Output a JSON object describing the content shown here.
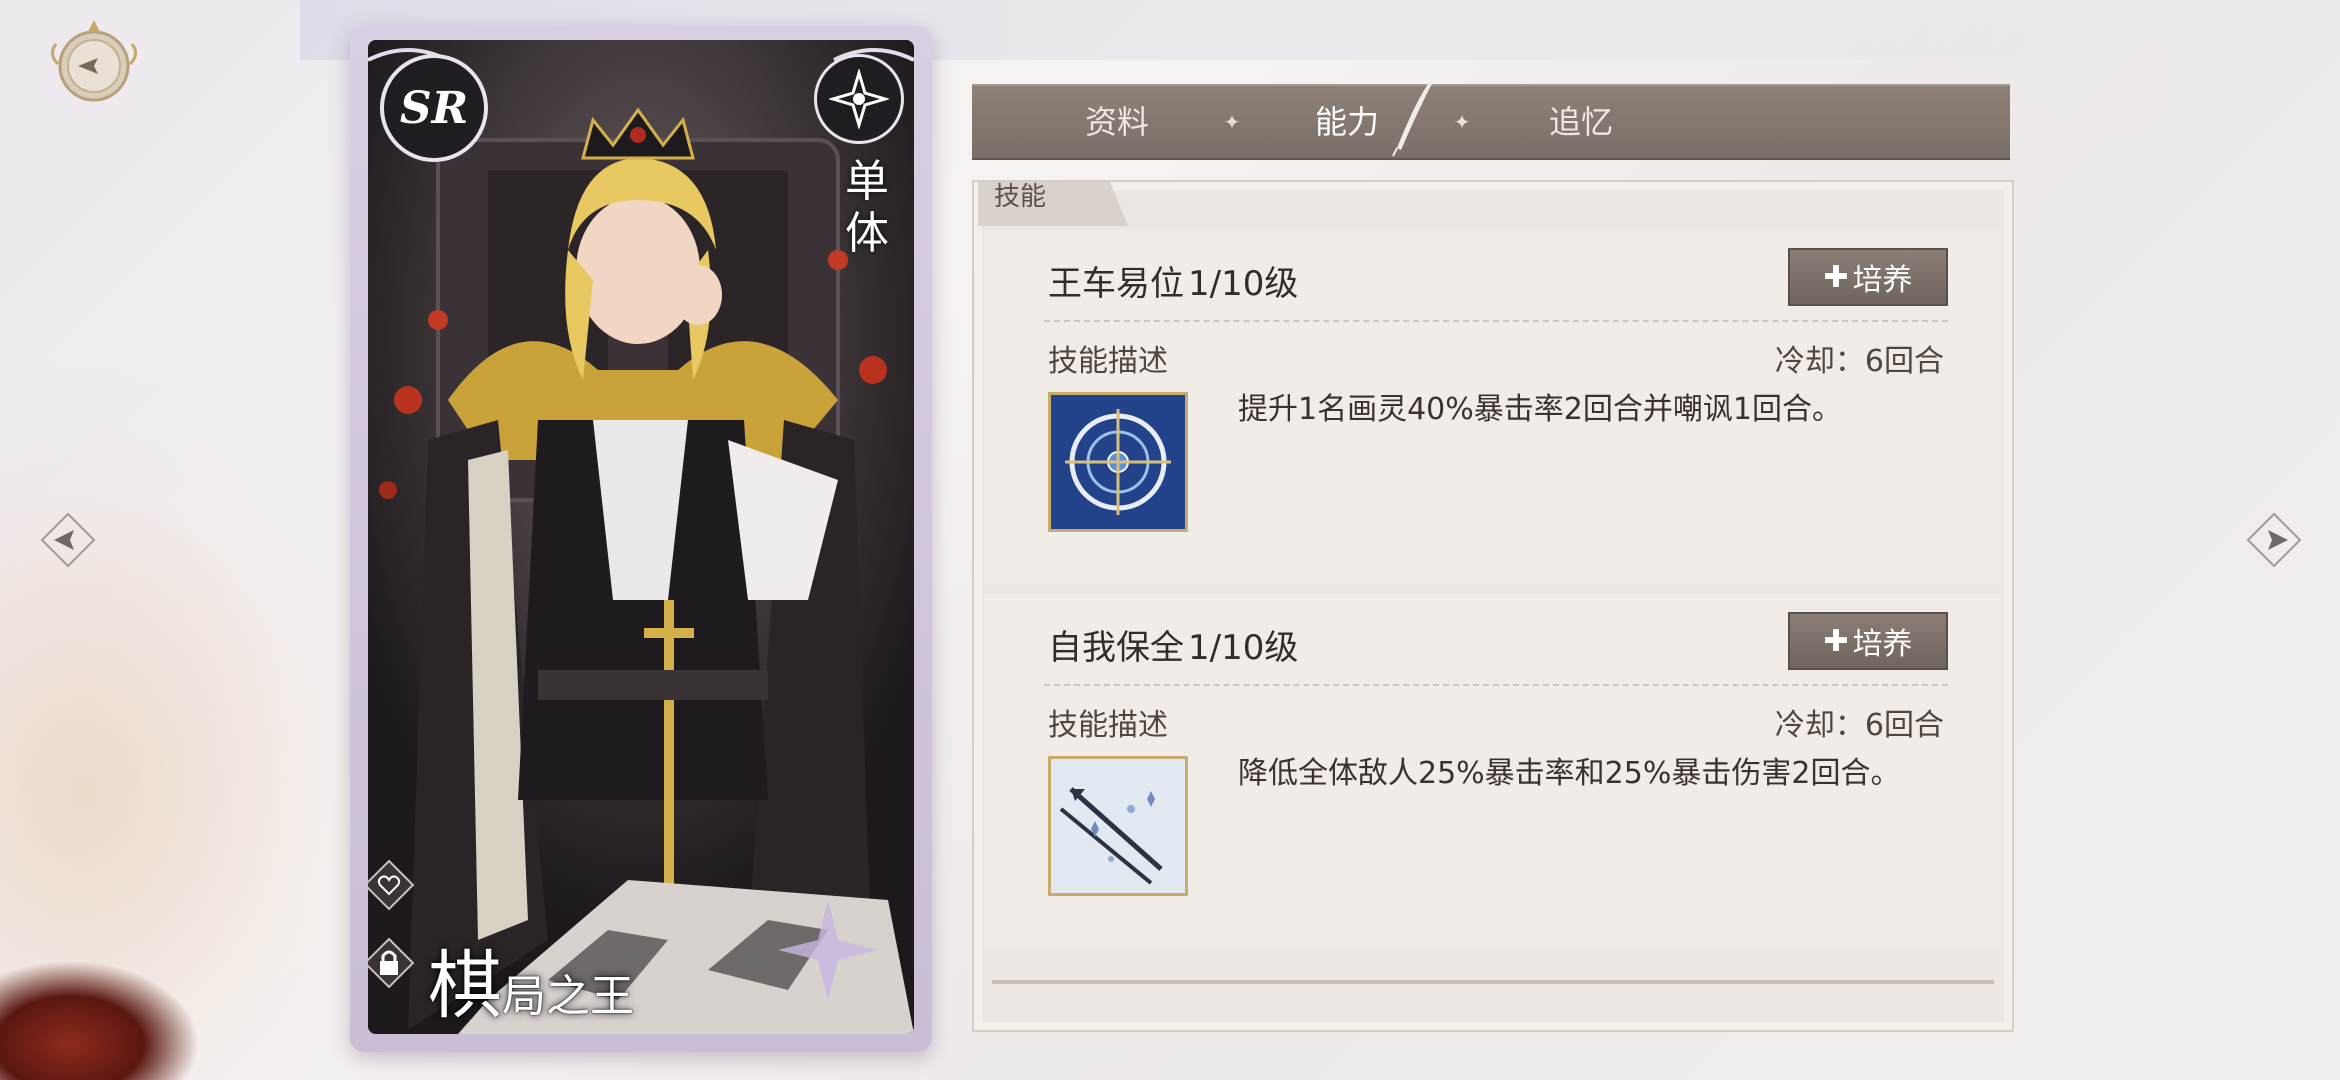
{
  "card": {
    "rarity": "SR",
    "target": "单体",
    "name_big": "棋",
    "name_rest": "局之王"
  },
  "tabs": [
    {
      "label": "资料",
      "active": false
    },
    {
      "label": "能力",
      "active": true
    },
    {
      "label": "追忆",
      "active": false
    }
  ],
  "panel": {
    "section_label": "技能",
    "skills": [
      {
        "name": "王车易位",
        "level": "1/10级",
        "train_label": "培养",
        "desc_label": "技能描述",
        "cooldown": "冷却：6回合",
        "description": "提升1名画灵40%暴击率2回合并嘲讽1回合。",
        "icon": "compass-target-icon"
      },
      {
        "name": "自我保全",
        "level": "1/10级",
        "train_label": "培养",
        "desc_label": "技能描述",
        "cooldown": "冷却：6回合",
        "description": "降低全体敌人25%暴击率和25%暴击伤害2回合。",
        "icon": "arrows-snowflake-icon"
      }
    ]
  },
  "colors": {
    "tab_bar": "#7a6f66",
    "panel_bg": "#ece7e2",
    "button_bg": "#7a6f66",
    "icon_frame": "#c9ab6c"
  }
}
